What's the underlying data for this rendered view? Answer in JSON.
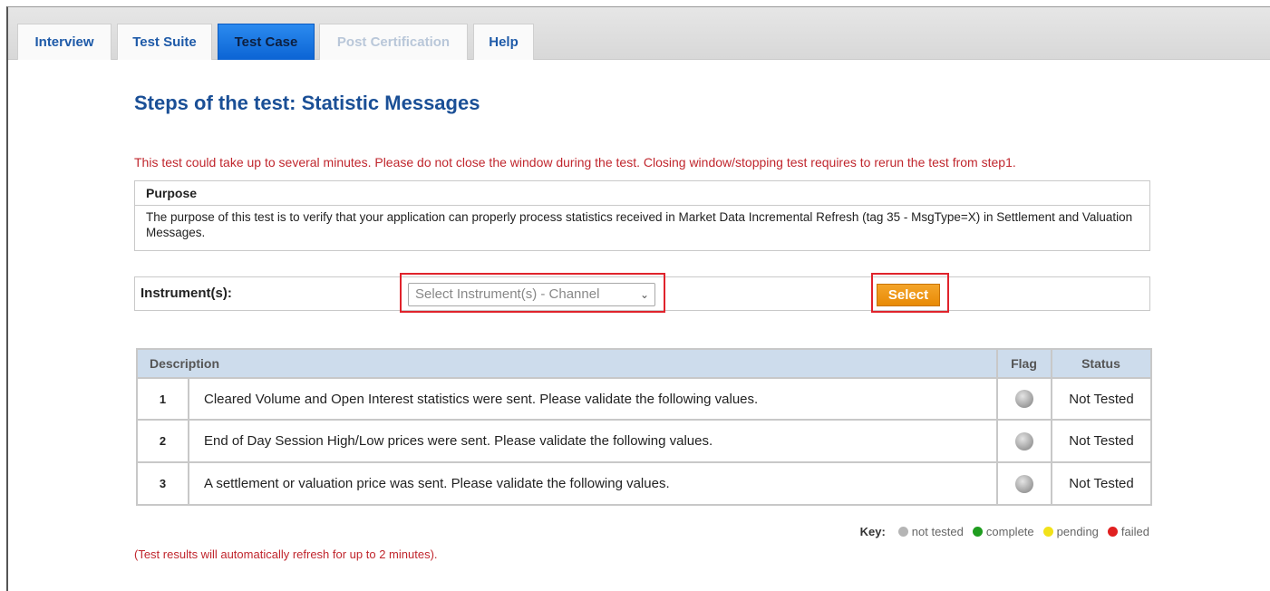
{
  "tabs": [
    {
      "label": "Interview",
      "state": "normal"
    },
    {
      "label": "Test Suite",
      "state": "normal"
    },
    {
      "label": "Test Case",
      "state": "active"
    },
    {
      "label": "Post Certification",
      "state": "disabled"
    },
    {
      "label": "Help",
      "state": "normal"
    }
  ],
  "page": {
    "title": "Steps of the test: Statistic Messages",
    "warning": "This test could take up to several minutes. Please do not close the window during the test. Closing window/stopping test requires to rerun the test from step1."
  },
  "purpose": {
    "heading": "Purpose",
    "text": "The purpose of this test is to verify that your application can properly process statistics received in Market Data Incremental Refresh (tag 35 - MsgType=X) in Settlement and Valuation Messages."
  },
  "instrument": {
    "label": "Instrument(s):",
    "select_value": "Select Instrument(s) - Channel",
    "button_label": "Select"
  },
  "table": {
    "headers": {
      "description": "Description",
      "flag": "Flag",
      "status": "Status"
    },
    "rows": [
      {
        "num": "1",
        "description": "Cleared Volume and Open Interest statistics were sent. Please validate the following values.",
        "flag": "grey",
        "status": "Not Tested"
      },
      {
        "num": "2",
        "description": "End of Day Session High/Low prices were sent. Please validate the following values.",
        "flag": "grey",
        "status": "Not Tested"
      },
      {
        "num": "3",
        "description": "A settlement or valuation price was sent. Please validate the following values.",
        "flag": "grey",
        "status": "Not Tested"
      }
    ]
  },
  "key": {
    "label": "Key:",
    "items": [
      {
        "label": "not tested",
        "color": "#b5b5b5"
      },
      {
        "label": "complete",
        "color": "#1f9d1f"
      },
      {
        "label": "pending",
        "color": "#f2e21a"
      },
      {
        "label": "failed",
        "color": "#e02020"
      }
    ]
  },
  "footer_note": "(Test results will automatically refresh for up to 2 minutes)."
}
